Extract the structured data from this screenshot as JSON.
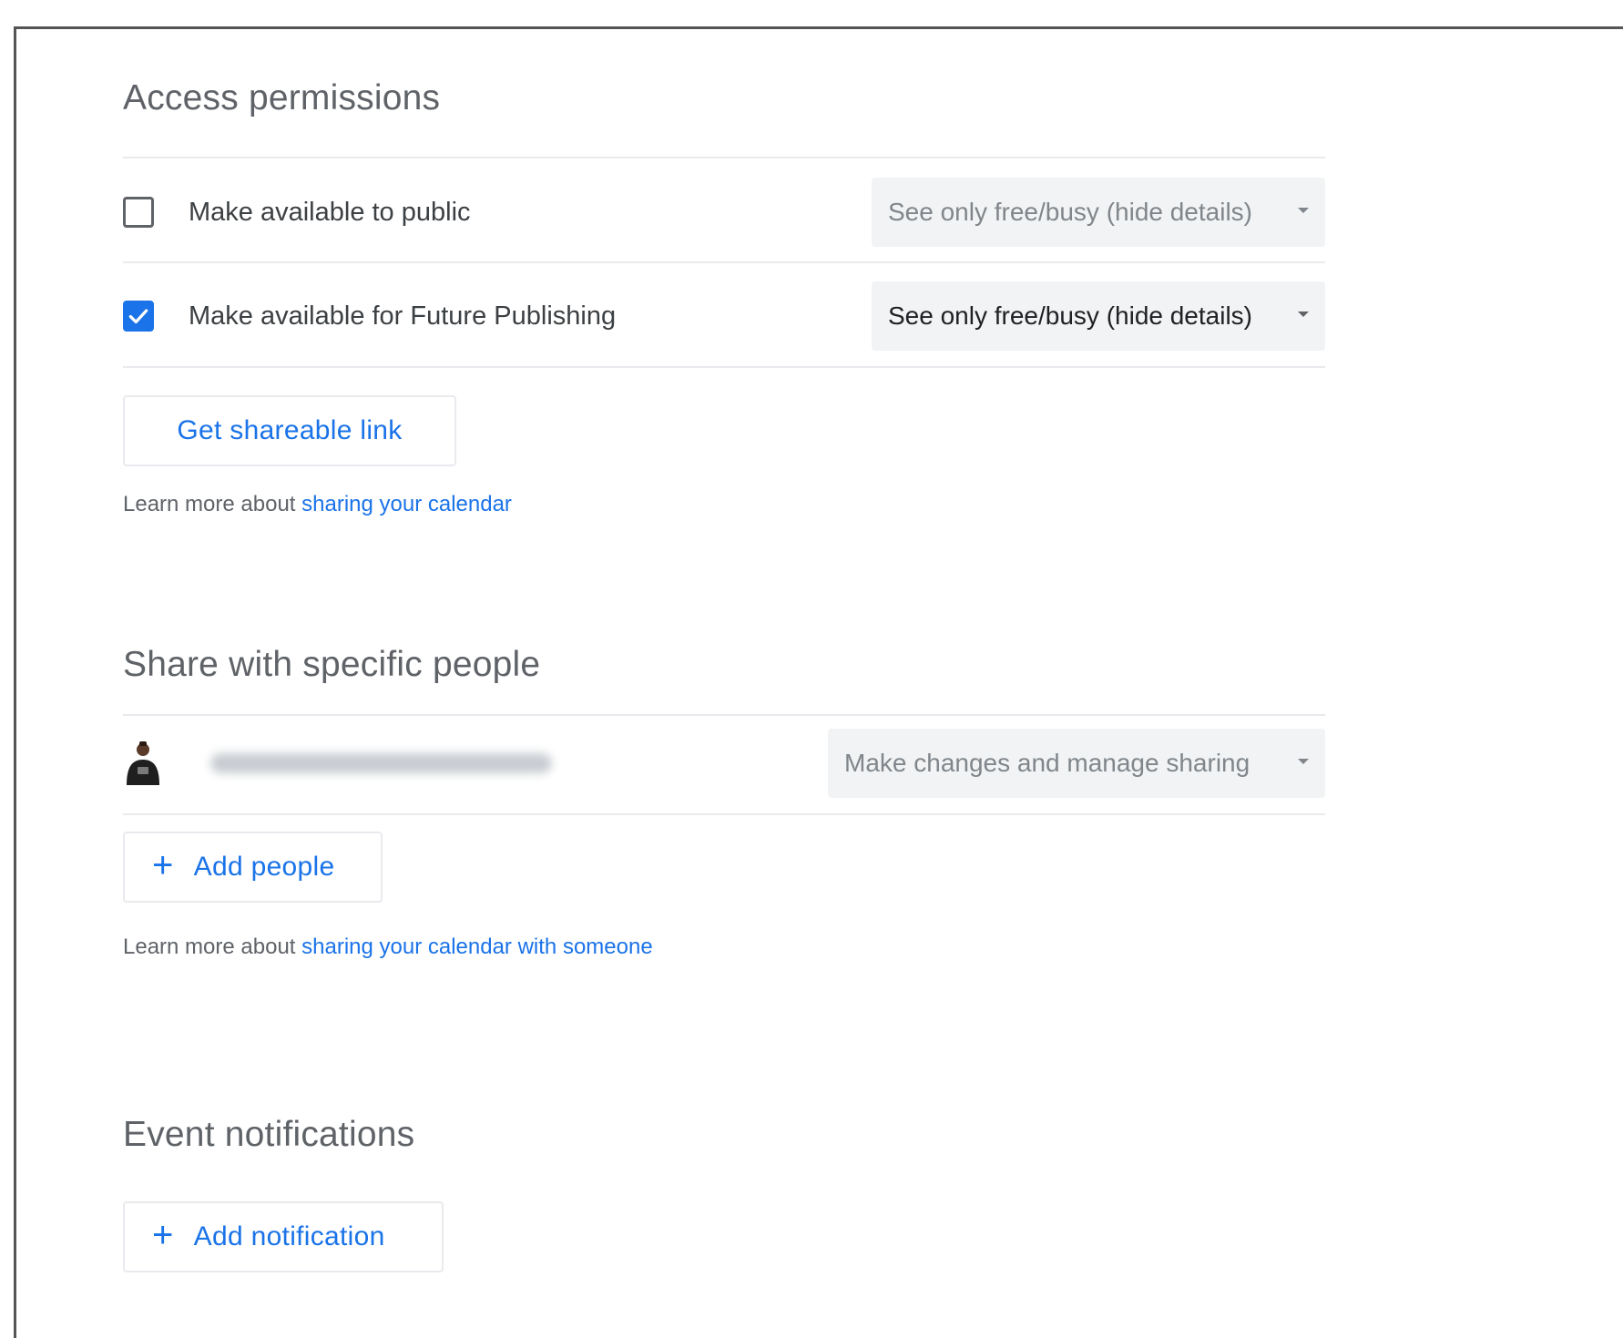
{
  "access_permissions": {
    "title": "Access permissions",
    "public_row": {
      "label": "Make available to public",
      "checked": false,
      "select_value": "See only free/busy (hide details)"
    },
    "org_row": {
      "label": "Make available for Future Publishing",
      "checked": true,
      "select_value": "See only free/busy (hide details)"
    },
    "shareable_link_button": "Get shareable link",
    "learn_prefix": "Learn more about ",
    "learn_link": "sharing your calendar"
  },
  "share_people": {
    "title": "Share with specific people",
    "person": {
      "permission": "Make changes and manage sharing"
    },
    "add_people_button": "Add people",
    "learn_prefix": "Learn more about ",
    "learn_link": "sharing your calendar with someone"
  },
  "event_notifications": {
    "title": "Event notifications",
    "add_notification_button": "Add notification"
  },
  "colors": {
    "accent": "#1a73e8",
    "checkbox_checked": "#1a73e8",
    "select_bg": "#f1f3f4",
    "divider": "#e8eaed"
  },
  "icons": {
    "checkbox_check": "check-icon",
    "dropdown": "caret-down-icon",
    "add": "plus-icon"
  }
}
